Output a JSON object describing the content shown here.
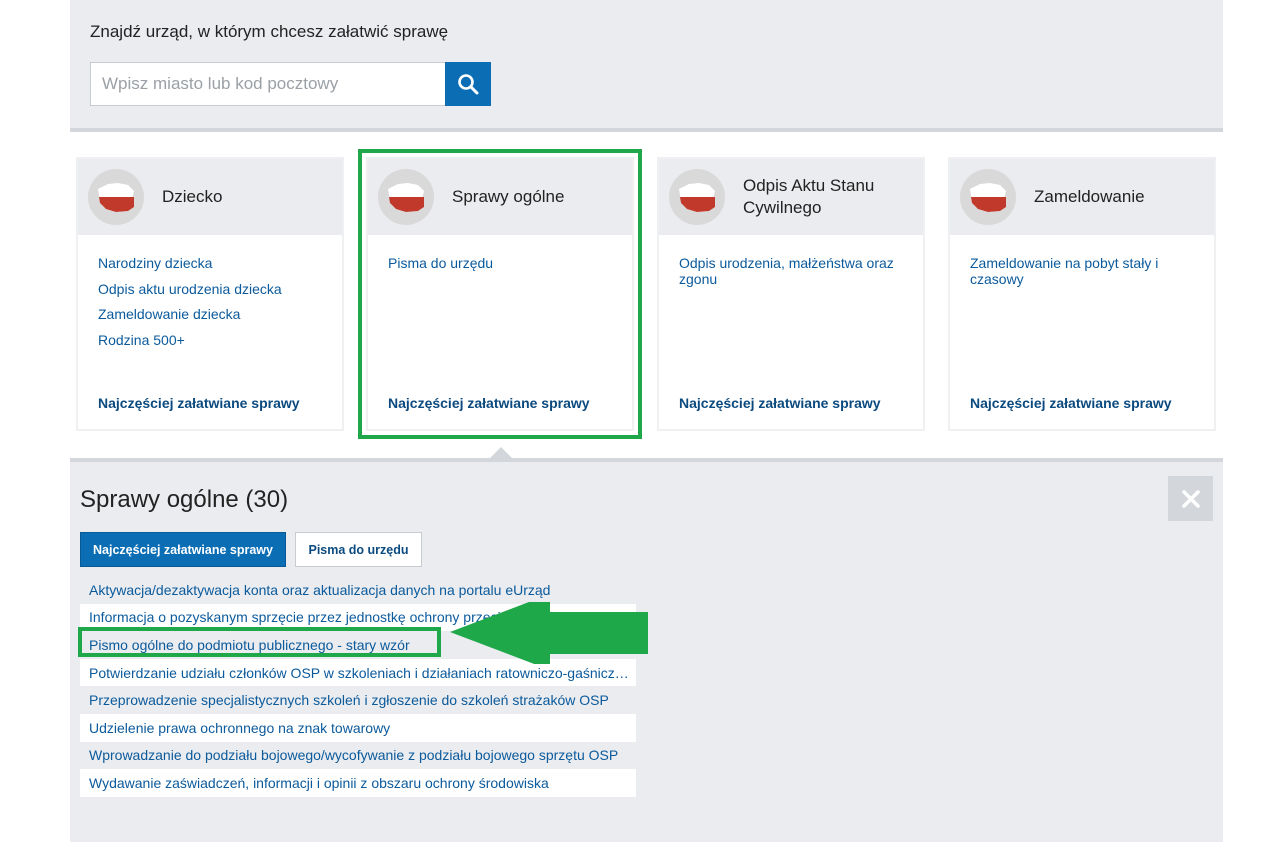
{
  "search": {
    "title": "Znajdź urząd, w którym chcesz załatwić sprawę",
    "placeholder": "Wpisz miasto lub kod pocztowy"
  },
  "cards": [
    {
      "title": "Dziecko",
      "links": [
        "Narodziny dziecka",
        "Odpis aktu urodzenia dziecka",
        "Zameldowanie dziecka",
        "Rodzina 500+"
      ],
      "footer": "Najczęściej załatwiane sprawy"
    },
    {
      "title": "Sprawy ogólne",
      "links": [
        "Pisma do urzędu"
      ],
      "footer": "Najczęściej załatwiane sprawy"
    },
    {
      "title": "Odpis Aktu Stanu Cywilnego",
      "links": [
        "Odpis urodzenia, małżeństwa oraz zgonu"
      ],
      "footer": "Najczęściej załatwiane sprawy"
    },
    {
      "title": "Zameldowanie",
      "links": [
        "Zameldowanie na pobyt stały i czasowy"
      ],
      "footer": "Najczęściej załatwiane sprawy"
    }
  ],
  "detail": {
    "title": "Sprawy ogólne (30)",
    "tab_active": "Najczęściej załatwiane sprawy",
    "tab_other": "Pisma do urzędu",
    "items": [
      "Aktywacja/dezaktywacja konta oraz aktualizacja danych na portalu eUrząd",
      "Informacja o pozyskanym sprzęcie przez jednostkę ochrony przeciwpożarowej",
      "Pismo ogólne do podmiotu publicznego - stary wzór",
      "Potwierdzanie udziału członków OSP w szkoleniach i działaniach ratowniczo-gaśnicz…",
      "Przeprowadzenie specjalistycznych szkoleń i zgłoszenie do szkoleń strażaków OSP",
      "Udzielenie prawa ochronnego na znak towarowy",
      "Wprowadzanie do podziału bojowego/wycofywanie z podziału bojowego sprzętu OSP",
      "Wydawanie zaświadczeń, informacji i opinii z obszaru ochrony środowiska"
    ]
  },
  "colors": {
    "primary": "#0b6eb5",
    "link": "#0b5a9c",
    "highlight": "#1ea84a",
    "panel": "#eaecef",
    "flag_red": "#c0392b"
  },
  "icons": {
    "search": "search-icon",
    "close": "close-icon",
    "emblem": "poland-map-icon",
    "annotation": "green-arrow-icon"
  }
}
